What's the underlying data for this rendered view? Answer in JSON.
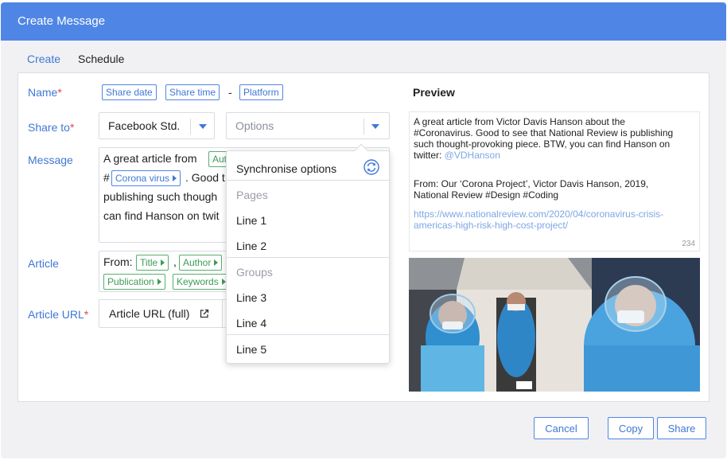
{
  "window": {
    "title": "Create Message"
  },
  "tabs": [
    {
      "label": "Create"
    },
    {
      "label": "Schedule"
    }
  ],
  "form": {
    "name": {
      "label": "Name",
      "required_mark": "*",
      "chips": [
        "Share date",
        "Share time",
        "Platform"
      ],
      "separator": "-"
    },
    "share_to": {
      "label": "Share to",
      "required_mark": "*",
      "platform_value": "Facebook Std.",
      "options_placeholder": "Options"
    },
    "message": {
      "label": "Message",
      "line1_prefix": "A great article from",
      "line1_chip": "Aut",
      "line2_prefix": "#",
      "line2_chip": "Corona virus",
      "line2_suffix": ". Good t",
      "line3": "publishing such though",
      "line4": "can find Hanson on twit"
    },
    "article": {
      "label": "Article",
      "prefix": "From:",
      "chips_row1": [
        "Title",
        "Author"
      ],
      "comma": ",",
      "chips_row2": [
        "Publication",
        "Keywords"
      ]
    },
    "article_url": {
      "label": "Article URL",
      "required_mark": "*",
      "value": "Article URL (full)"
    }
  },
  "dropdown": {
    "sync_label": "Synchronise options",
    "groups": [
      {
        "title": "Pages",
        "items": [
          "Line 1",
          "Line 2"
        ]
      },
      {
        "title": "Groups",
        "items": [
          "Line 3",
          "Line 4"
        ]
      }
    ],
    "extra_item": "Line 5"
  },
  "preview": {
    "title": "Preview",
    "text_line1": "A great article from Victor Davis Hanson about the",
    "text_line2": "#Coronavirus. Good to see that National Review is publishing",
    "text_line3": "such thought-provoking piece. BTW, you can find Hanson on",
    "text_line4_prefix": "twitter: ",
    "mention": "@VDHanson",
    "from_line1": "From: Our ‘Corona Project’, Victor Davis Hanson, 2019,",
    "from_line2": "National Review #Design #Coding",
    "url_line1": "https://www.nationalreview.com/2020/04/coronavirus-crisis-",
    "url_line2": "americas-high-risk-high-cost-project/",
    "char_count": "234"
  },
  "buttons": {
    "cancel": "Cancel",
    "copy": "Copy",
    "share": "Share"
  },
  "colors": {
    "header": "#4f86e6",
    "accent": "#3f78d6",
    "chip_green": "#3e9a56",
    "required": "#e04646"
  }
}
